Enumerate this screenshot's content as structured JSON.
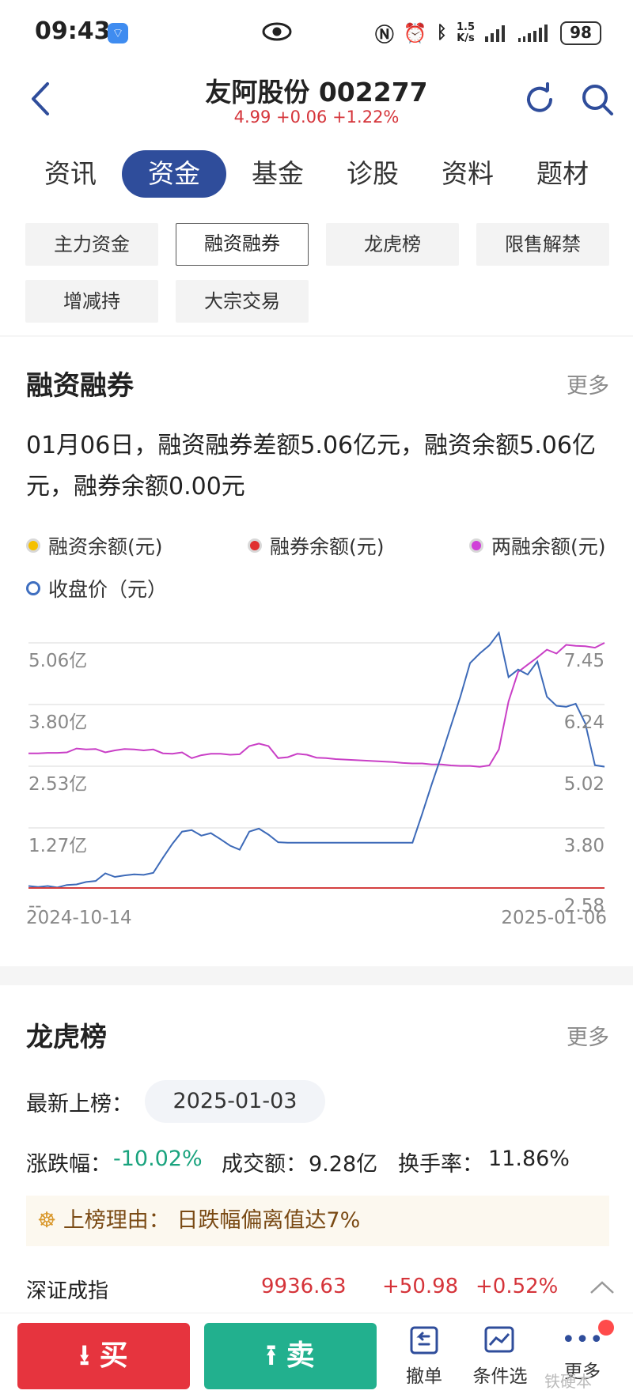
{
  "status_bar": {
    "time": "09:43",
    "speed_value": "1.5",
    "speed_unit": "K/s",
    "battery": "98"
  },
  "header": {
    "title": "友阿股份 002277",
    "price_line": "4.99 +0.06 +1.22%"
  },
  "main_tabs": [
    {
      "label": "资讯",
      "active": false
    },
    {
      "label": "资金",
      "active": true
    },
    {
      "label": "基金",
      "active": false
    },
    {
      "label": "诊股",
      "active": false
    },
    {
      "label": "资料",
      "active": false
    },
    {
      "label": "题材",
      "active": false
    }
  ],
  "sub_tabs": [
    {
      "label": "主力资金",
      "active": false
    },
    {
      "label": "融资融券",
      "active": true
    },
    {
      "label": "龙虎榜",
      "active": false
    },
    {
      "label": "限售解禁",
      "active": false
    },
    {
      "label": "增减持",
      "active": false
    },
    {
      "label": "大宗交易",
      "active": false
    }
  ],
  "margin_section": {
    "title": "融资融券",
    "more": "更多",
    "summary": "01月06日，融资融券差额5.06亿元，融资余额5.06亿元，融券余额0.00元",
    "legend": [
      {
        "label": "融资余额(元)",
        "color": "#f5c000"
      },
      {
        "label": "融券余额(元)",
        "color": "#e03030"
      },
      {
        "label": "两融余额(元)",
        "color": "#d040d8"
      },
      {
        "label": "收盘价（元）",
        "color": "#3f6fc0"
      }
    ]
  },
  "chart_data": {
    "type": "line",
    "x_start": "2024-10-14",
    "x_end": "2025-01-06",
    "left_axis_ticks": [
      "5.06亿",
      "3.80亿",
      "2.53亿",
      "1.27亿",
      "--"
    ],
    "right_axis_ticks": [
      "7.45",
      "6.24",
      "5.02",
      "3.80",
      "2.58"
    ],
    "left_ylim": [
      0,
      5.06
    ],
    "right_ylim": [
      2.58,
      7.45
    ],
    "series": [
      {
        "name": "两融余额(元)",
        "color": "#c93fc6",
        "axis": "left",
        "unit": "亿",
        "values": [
          2.78,
          2.78,
          2.79,
          2.79,
          2.8,
          2.88,
          2.86,
          2.87,
          2.8,
          2.84,
          2.87,
          2.86,
          2.84,
          2.86,
          2.78,
          2.77,
          2.8,
          2.68,
          2.74,
          2.77,
          2.77,
          2.75,
          2.76,
          2.93,
          2.98,
          2.93,
          2.68,
          2.7,
          2.77,
          2.75,
          2.69,
          2.68,
          2.66,
          2.65,
          2.64,
          2.63,
          2.62,
          2.61,
          2.6,
          2.58,
          2.57,
          2.57,
          2.55,
          2.55,
          2.53,
          2.52,
          2.52,
          2.5,
          2.53,
          2.86,
          3.85,
          4.46,
          4.61,
          4.76,
          4.92,
          4.84,
          5.02,
          5.0,
          4.99,
          4.96,
          5.06
        ]
      },
      {
        "name": "收盘价（元）",
        "color": "#3d6ab8",
        "axis": "right",
        "unit": "元",
        "values": [
          2.62,
          2.6,
          2.62,
          2.59,
          2.64,
          2.65,
          2.7,
          2.72,
          2.87,
          2.8,
          2.83,
          2.85,
          2.84,
          2.88,
          3.18,
          3.46,
          3.7,
          3.73,
          3.62,
          3.67,
          3.55,
          3.42,
          3.34,
          3.7,
          3.76,
          3.64,
          3.49,
          3.48,
          3.48,
          3.48,
          3.48,
          3.48,
          3.48,
          3.48,
          3.48,
          3.48,
          3.48,
          3.48,
          3.48,
          3.48,
          3.48,
          4.05,
          4.64,
          5.2,
          5.8,
          6.39,
          7.05,
          7.24,
          7.4,
          7.65,
          6.77,
          6.92,
          6.82,
          7.08,
          6.38,
          6.2,
          6.18,
          6.24,
          5.85,
          5.02,
          4.99
        ]
      },
      {
        "name": "融券余额(元)",
        "color": "#d44040",
        "axis": "left",
        "unit": "亿",
        "values": [
          0,
          0
        ]
      }
    ]
  },
  "dragon_section": {
    "title": "龙虎榜",
    "more": "更多",
    "latest_label": "最新上榜：",
    "latest_date": "2025-01-03",
    "change_label": "涨跌幅：",
    "change_value": "-10.02%",
    "amount_label": "成交额：",
    "amount_value": "9.28亿",
    "turnover_label": "换手率：",
    "turnover_value": "11.86%",
    "reason_label": "上榜理由：",
    "reason_value": "日跌幅偏离值达7%"
  },
  "index_bar": {
    "name": "深证成指",
    "value": "9936.63",
    "change": "+50.98",
    "pct": "+0.52%"
  },
  "bottom_bar": {
    "buy": "买",
    "sell": "卖",
    "cancel": "撤单",
    "condition": "条件选",
    "more": "更多",
    "watermark": "铁硬本"
  }
}
